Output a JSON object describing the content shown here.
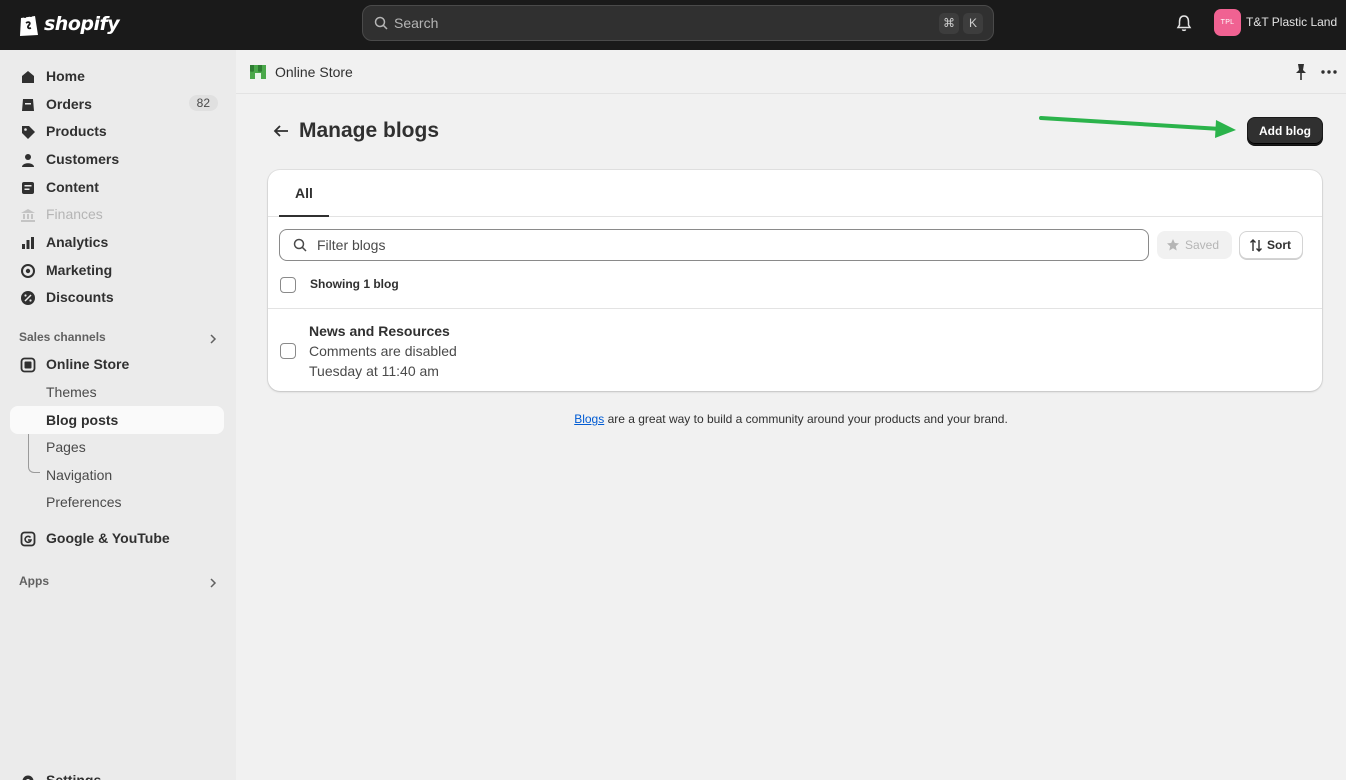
{
  "topbar": {
    "logo_text": "shopify",
    "search_placeholder": "Search",
    "shortcut_key1": "⌘",
    "shortcut_key2": "K",
    "store_initials": "TPL",
    "store_name": "T&T Plastic Land"
  },
  "sidebar": {
    "items": [
      {
        "label": "Home",
        "icon": "home-icon"
      },
      {
        "label": "Orders",
        "icon": "orders-icon",
        "badge": "82"
      },
      {
        "label": "Products",
        "icon": "tag-icon"
      },
      {
        "label": "Customers",
        "icon": "person-icon"
      },
      {
        "label": "Content",
        "icon": "content-icon"
      },
      {
        "label": "Finances",
        "icon": "bank-icon"
      },
      {
        "label": "Analytics",
        "icon": "chart-icon"
      },
      {
        "label": "Marketing",
        "icon": "target-icon"
      },
      {
        "label": "Discounts",
        "icon": "discount-icon"
      }
    ],
    "sales_channels_label": "Sales channels",
    "online_store_label": "Online Store",
    "online_store_sub": [
      "Themes",
      "Blog posts",
      "Pages",
      "Navigation",
      "Preferences"
    ],
    "google_label": "Google & YouTube",
    "apps_label": "Apps",
    "settings_label": "Settings"
  },
  "subheader": {
    "title": "Online Store"
  },
  "page": {
    "title": "Manage blogs",
    "add_button": "Add blog",
    "tab_all": "All",
    "filter_placeholder": "Filter blogs",
    "saved_label": "Saved",
    "sort_label": "Sort",
    "showing_text": "Showing 1 blog",
    "blog": {
      "title": "News and Resources",
      "comments": "Comments are disabled",
      "updated": "Tuesday at 11:40 am"
    },
    "footer_link": "Blogs",
    "footer_text": " are a great way to build a community around your products and your brand."
  },
  "colors": {
    "topbar_bg": "#1a1a1a",
    "accent_arrow": "#2bb34b",
    "primary_button": "#303030",
    "link": "#005bd3",
    "avatar": "#f06292"
  }
}
